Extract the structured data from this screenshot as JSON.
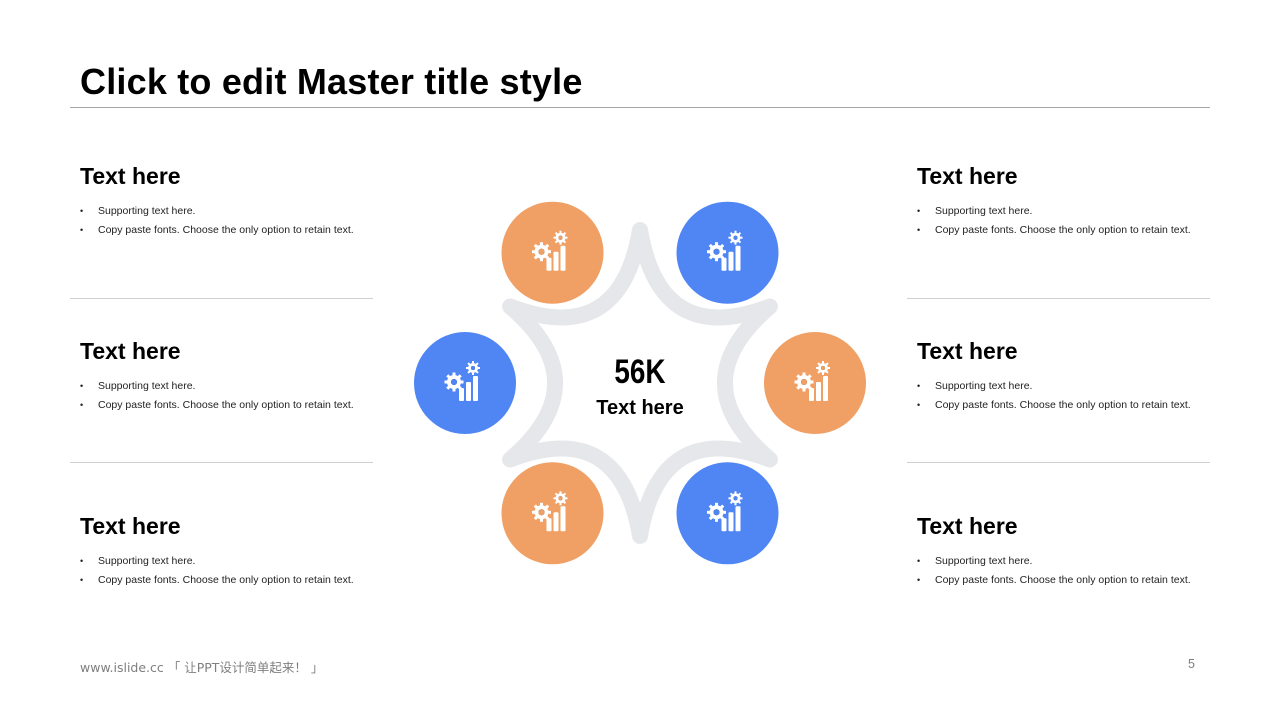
{
  "slide": {
    "title": "Click to edit Master title style",
    "footer": "www.islide.cc 「 让PPT设计简单起来！ 」",
    "page_number": "5"
  },
  "center": {
    "value": "56K",
    "label": "Text here"
  },
  "colors": {
    "orange": "#f0a064",
    "blue": "#4f86f4",
    "ring": "#e6e7ea"
  },
  "icons": {
    "node_icon": "gear-bar-chart-icon"
  },
  "blocks": [
    {
      "heading": "Text here",
      "bullets": [
        "Supporting text here.",
        "Copy paste fonts.  Choose the only  option to retain text."
      ]
    },
    {
      "heading": "Text here",
      "bullets": [
        "Supporting text here.",
        "Copy paste fonts.  Choose the only  option to retain text."
      ]
    },
    {
      "heading": "Text here",
      "bullets": [
        "Supporting text here.",
        "Copy paste fonts.  Choose the only  option to retain text."
      ]
    },
    {
      "heading": "Text here",
      "bullets": [
        "Supporting text here.",
        "Copy paste fonts.  Choose the only  option to retain text."
      ]
    },
    {
      "heading": "Text here",
      "bullets": [
        "Supporting text here.",
        "Copy paste fonts.  Choose the only  option to retain text."
      ]
    },
    {
      "heading": "Text here",
      "bullets": [
        "Supporting text here.",
        "Copy paste fonts.  Choose the only  option to retain text."
      ]
    }
  ]
}
